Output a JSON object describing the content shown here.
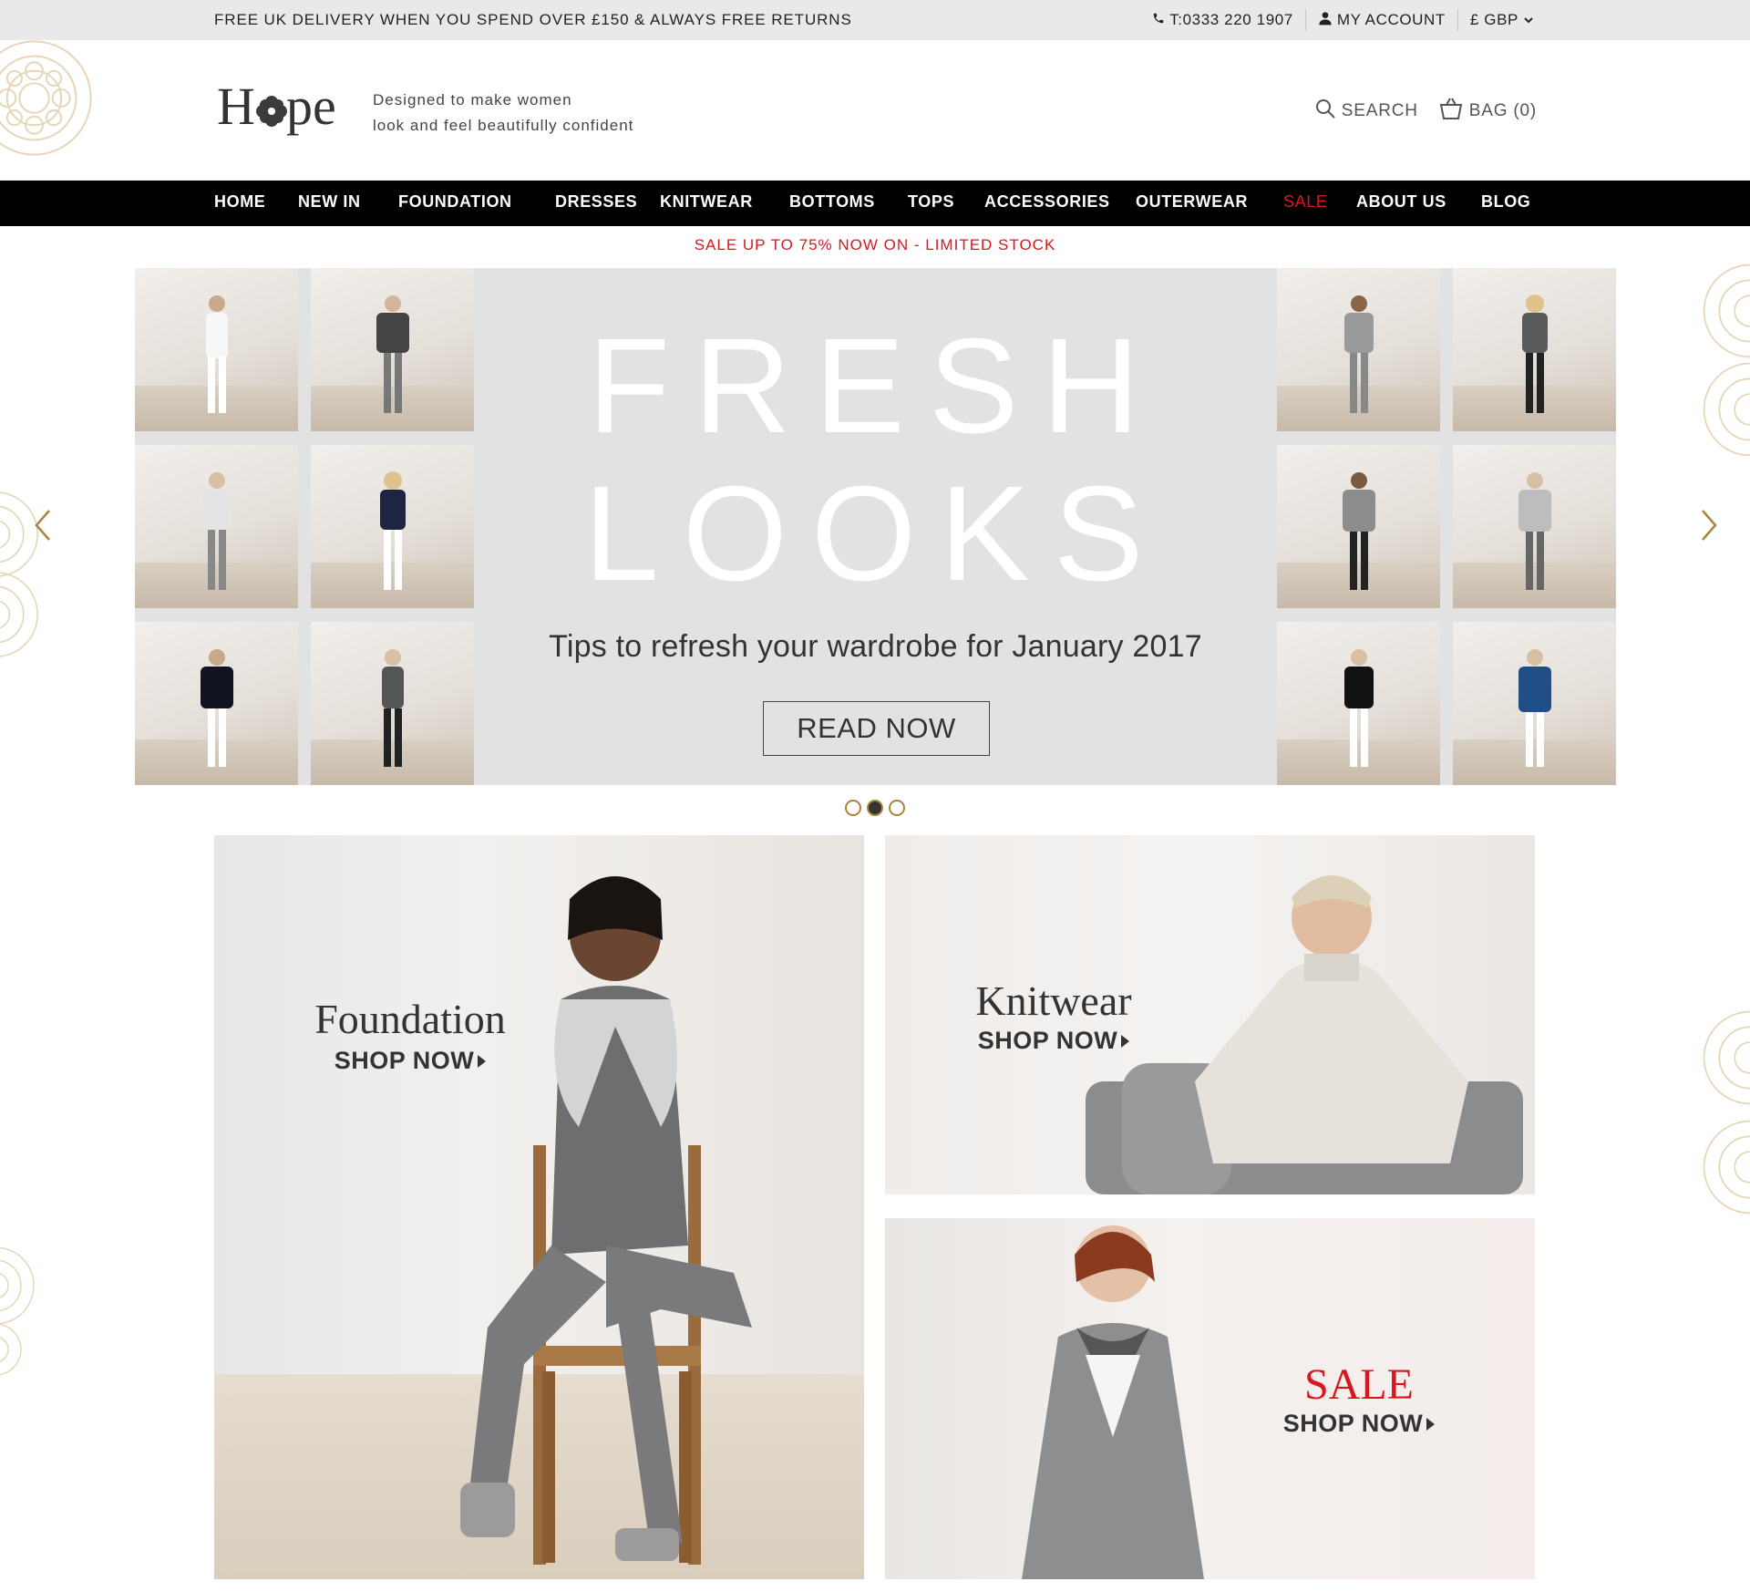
{
  "topbar": {
    "promo": "FREE UK DELIVERY WHEN YOU SPEND OVER £150 & ALWAYS FREE RETURNS",
    "phone": "T:0333 220 1907",
    "account": "MY ACCOUNT",
    "currency": "£ GBP"
  },
  "header": {
    "logo_text": "Hope",
    "tagline_line1": "Designed to make women",
    "tagline_line2": "look and feel beautifully confident",
    "search_label": "SEARCH",
    "bag_label": "BAG (0)"
  },
  "nav": {
    "items": [
      {
        "label": "HOME"
      },
      {
        "label": "NEW IN"
      },
      {
        "label": "FOUNDATION"
      },
      {
        "label": "DRESSES"
      },
      {
        "label": "KNITWEAR"
      },
      {
        "label": "BOTTOMS"
      },
      {
        "label": "TOPS"
      },
      {
        "label": "ACCESSORIES"
      },
      {
        "label": "OUTERWEAR"
      },
      {
        "label": "SALE"
      },
      {
        "label": "ABOUT US"
      },
      {
        "label": "BLOG"
      }
    ]
  },
  "sale_banner": "SALE UP TO 75% NOW ON - LIMITED STOCK",
  "hero": {
    "title_line1": "FRESH",
    "title_line2": "LOOKS",
    "subtitle": "Tips to refresh your wardrobe for January 2017",
    "button": "READ NOW",
    "active_slide": 2,
    "slide_count": 3
  },
  "tiles": {
    "foundation": {
      "title": "Foundation",
      "cta": "SHOP NOW"
    },
    "knitwear": {
      "title": "Knitwear",
      "cta": "SHOP NOW"
    },
    "sale": {
      "title": "SALE",
      "cta": "SHOP NOW"
    }
  },
  "colors": {
    "accent_red": "#d9161f",
    "gold": "#a8843f",
    "nav_bg": "#000000",
    "topbar_bg": "#e9e9e9"
  }
}
